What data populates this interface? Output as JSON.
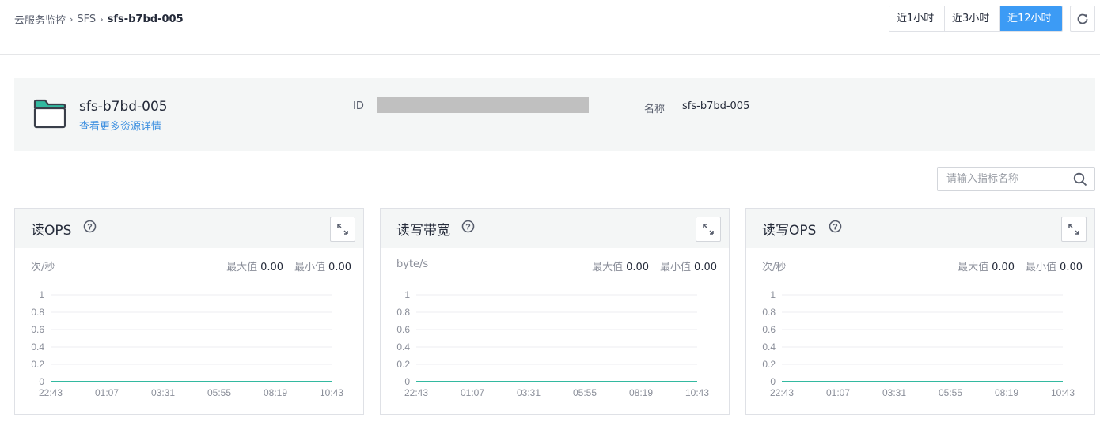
{
  "breadcrumb": {
    "items": [
      "云服务监控",
      "SFS"
    ],
    "current": "sfs-b7bd-005"
  },
  "time_range": {
    "options": [
      "近1小时",
      "近3小时",
      "近12小时"
    ],
    "selected": "近12小时"
  },
  "refresh_icon": "refresh-icon",
  "resource": {
    "icon": "folder-icon",
    "name": "sfs-b7bd-005",
    "details_link": "查看更多资源详情",
    "id_label": "ID",
    "id_value": "",
    "name_label": "名称",
    "name_value": "sfs-b7bd-005"
  },
  "search": {
    "placeholder": "请输入指标名称",
    "icon": "search-icon"
  },
  "colors": {
    "accent": "#3c9bf5",
    "link": "#3c8fe0",
    "series": "#33b9a0",
    "panel_bg": "#f4f6f6"
  },
  "charts": [
    {
      "title": "读OPS",
      "unit": "次/秒",
      "max_label": "最大值",
      "max_value": "0.00",
      "min_label": "最小值",
      "min_value": "0.00"
    },
    {
      "title": "读写带宽",
      "unit": "byte/s",
      "max_label": "最大值",
      "max_value": "0.00",
      "min_label": "最小值",
      "min_value": "0.00"
    },
    {
      "title": "读写OPS",
      "unit": "次/秒",
      "max_label": "最大值",
      "max_value": "0.00",
      "min_label": "最小值",
      "min_value": "0.00"
    }
  ],
  "chart_data": [
    {
      "type": "line",
      "title": "读OPS",
      "ylabel": "次/秒",
      "x": [
        "22:43",
        "01:07",
        "03:31",
        "05:55",
        "08:19",
        "10:43"
      ],
      "yticks": [
        "0",
        "0.2",
        "0.4",
        "0.6",
        "0.8",
        "1"
      ],
      "ylim": [
        0,
        1
      ],
      "grid": true,
      "series": [
        {
          "values": [
            0,
            0,
            0,
            0,
            0,
            0
          ]
        }
      ]
    },
    {
      "type": "line",
      "title": "读写带宽",
      "ylabel": "byte/s",
      "x": [
        "22:43",
        "01:07",
        "03:31",
        "05:55",
        "08:19",
        "10:43"
      ],
      "yticks": [
        "0",
        "0.2",
        "0.4",
        "0.6",
        "0.8",
        "1"
      ],
      "ylim": [
        0,
        1
      ],
      "grid": true,
      "series": [
        {
          "values": [
            0,
            0,
            0,
            0,
            0,
            0
          ]
        }
      ]
    },
    {
      "type": "line",
      "title": "读写OPS",
      "ylabel": "次/秒",
      "x": [
        "22:43",
        "01:07",
        "03:31",
        "05:55",
        "08:19",
        "10:43"
      ],
      "yticks": [
        "0",
        "0.2",
        "0.4",
        "0.6",
        "0.8",
        "1"
      ],
      "ylim": [
        0,
        1
      ],
      "grid": true,
      "series": [
        {
          "values": [
            0,
            0,
            0,
            0,
            0,
            0
          ]
        }
      ]
    }
  ]
}
